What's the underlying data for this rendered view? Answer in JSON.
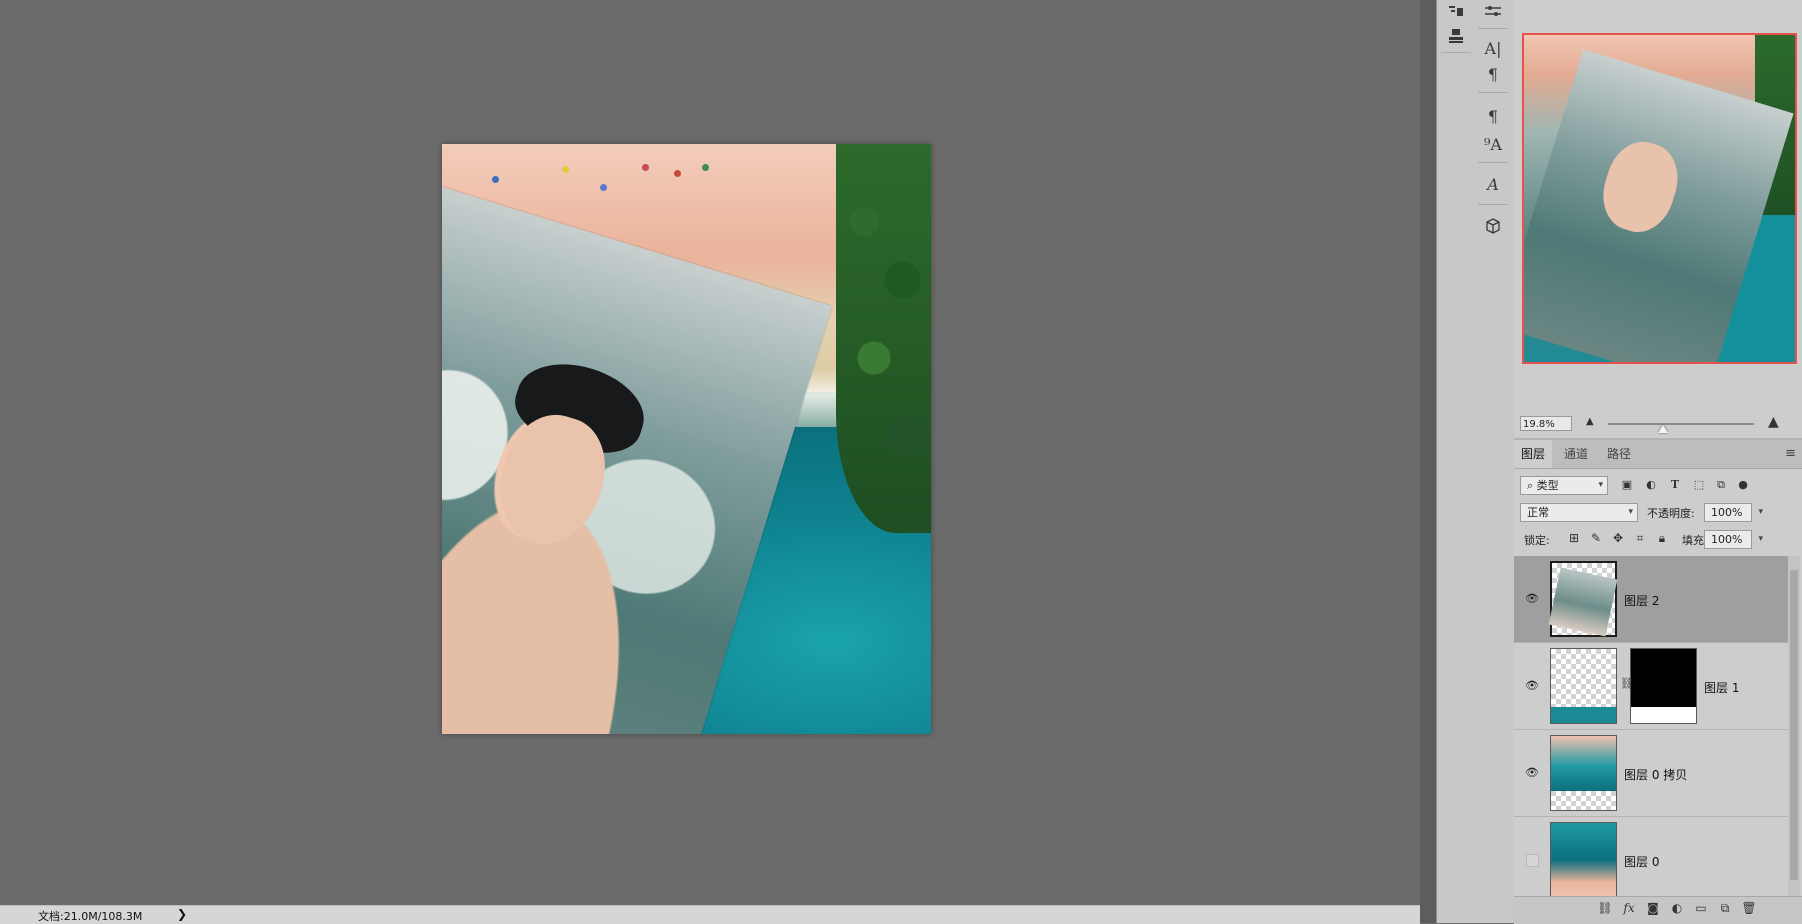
{
  "status_bar": {
    "doc_info": "文档:21.0M/108.3M",
    "arrow": "❯"
  },
  "navigator": {
    "zoom": "19.8%"
  },
  "layers_panel": {
    "tabs": [
      "图层",
      "通道",
      "路径"
    ],
    "filter_kind": "类型",
    "blend_mode": "正常",
    "opacity_label": "不透明度:",
    "opacity_value": "100%",
    "lock_label": "锁定:",
    "fill_label": "填充:",
    "fill_value": "100%",
    "layers": [
      {
        "name": "图层 2",
        "visible": true,
        "selected": true
      },
      {
        "name": "图层 1",
        "visible": true,
        "selected": false,
        "has_mask": true
      },
      {
        "name": "图层 0 拷贝",
        "visible": true,
        "selected": false
      },
      {
        "name": "图层 0",
        "visible": false,
        "selected": false
      }
    ]
  },
  "tool_icons": {
    "strip_b": [
      "paragraph-styles-icon",
      "stamp-icon"
    ],
    "strip_c": [
      "adjustments-icon",
      "character-icon",
      "paragraph-icon",
      "paragraph-style-icon",
      "character-style-icon",
      "glyphs-icon",
      "3d-cube-icon"
    ]
  },
  "colors": {
    "canvas_bg": "#6b6b6b",
    "panel_bg": "#cdcdcd",
    "navigator_frame": "#e5524d",
    "selected_layer": "#9f9f9f"
  }
}
